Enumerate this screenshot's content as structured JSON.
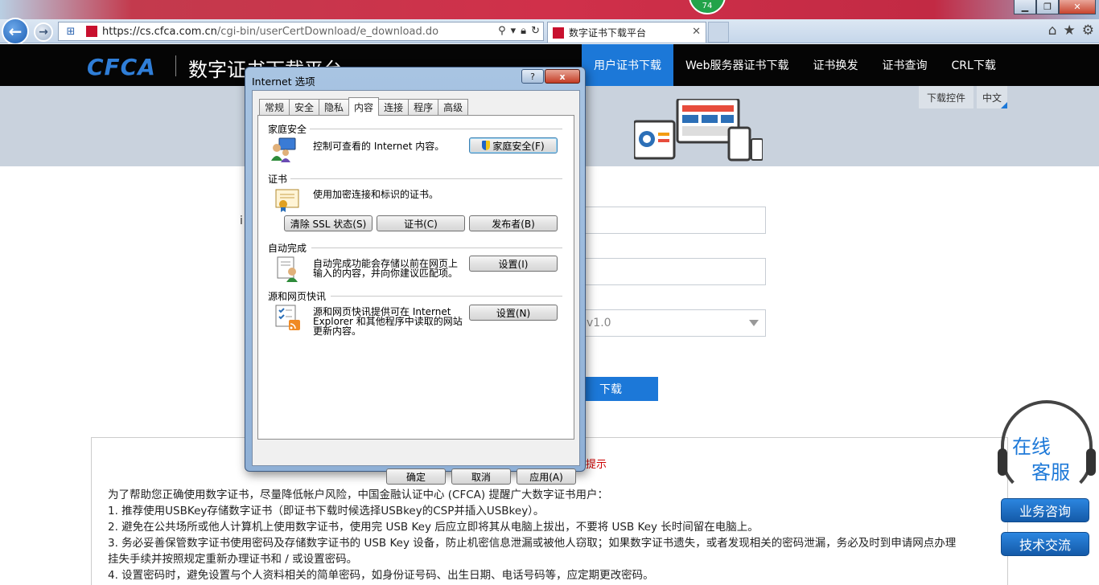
{
  "browser": {
    "notification_badge": "74",
    "url_prefix": "https://cs.",
    "url_domain": "cfca.com.cn",
    "url_path": "/cgi-bin/userCertDownload/e_download.do",
    "tab_title": "数字证书下载平台"
  },
  "site": {
    "logo": "CFCA",
    "title": "数字证书下载平台",
    "menu": [
      "用户证书下载",
      "Web服务器证书下载",
      "证书换发",
      "证书查询",
      "CRL下载"
    ],
    "sub_download_control": "下载控件",
    "sub_language": "中文",
    "form_select_value": "v1.0",
    "form_left_char": "i",
    "download_button": "下载",
    "notice_title_fragment": "提示",
    "notice_lines": [
      "为了帮助您正确使用数字证书，尽量降低帐户风险，中国金融认证中心 (CFCA) 提醒广大数字证书用户：",
      "1. 推荐使用USBKey存储数字证书（即证书下载时候选择USBkey的CSP并插入USBkey）。",
      "2. 避免在公共场所或他人计算机上使用数字证书，使用完 USB Key 后应立即将其从电脑上拔出，不要将 USB Key 长时间留在电脑上。",
      "3. 务必妥善保管数字证书使用密码及存储数字证书的 USB Key 设备，防止机密信息泄漏或被他人窃取；如果数字证书遗失，或者发现相关的密码泄漏，务必及时到申请网点办理",
      "挂失手续并按照规定重新办理证书和 / 或设置密码。",
      "4. 设置密码时，避免设置与个人资料相关的简单密码，如身份证号码、出生日期、电话号码等，应定期更改密码。"
    ],
    "cs_widget_line1": "在线",
    "cs_widget_line2": "客服",
    "side_buttons": [
      "业务咨询",
      "技术交流"
    ]
  },
  "dialog": {
    "title": "Internet 选项",
    "help": "?",
    "close": "x",
    "tabs": [
      "常规",
      "安全",
      "隐私",
      "内容",
      "连接",
      "程序",
      "高级"
    ],
    "active_tab": "内容",
    "family_safety": {
      "heading": "家庭安全",
      "description": "控制可查看的 Internet 内容。",
      "button": "家庭安全(F)"
    },
    "certificates": {
      "heading": "证书",
      "description": "使用加密连接和标识的证书。",
      "buttons": [
        "清除 SSL 状态(S)",
        "证书(C)",
        "发布者(B)"
      ]
    },
    "autocomplete": {
      "heading": "自动完成",
      "description_line1": "自动完成功能会存储以前在网页上",
      "description_line2": "输入的内容，并向你建议匹配项。",
      "button": "设置(I)"
    },
    "feeds": {
      "heading": "源和网页快讯",
      "description_line1": "源和网页快讯提供可在 Internet",
      "description_line2": "Explorer 和其他程序中读取的网站",
      "description_line3": "更新内容。",
      "button": "设置(N)"
    },
    "footer_buttons": [
      "确定",
      "取消",
      "应用(A)"
    ]
  }
}
